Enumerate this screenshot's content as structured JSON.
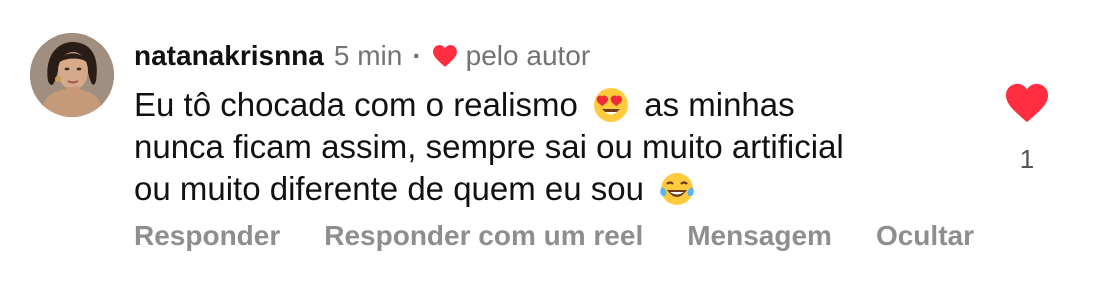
{
  "comment": {
    "username": "natanakrisnna",
    "time": "5 min",
    "separator": "·",
    "author_label": "pelo autor",
    "text_line1_before": "Eu tô chocada com o realismo",
    "text_line1_after": "as minhas",
    "text_line2": "nunca ficam assim, sempre sai ou muito artificial",
    "text_line3": "ou muito diferente de quem eu sou",
    "emoji1": "heart-eyes-emoji",
    "emoji2": "laughing-tears-emoji",
    "like_count": "1"
  },
  "actions": {
    "reply": "Responder",
    "reply_reel": "Responder com um reel",
    "message": "Mensagem",
    "hide": "Ocultar"
  },
  "colors": {
    "heart": "#ff2d3f",
    "secondary_text": "#737373",
    "action_text": "#8e8e8e",
    "primary_text": "#111111"
  }
}
